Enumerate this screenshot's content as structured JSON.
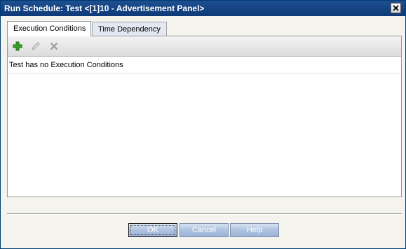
{
  "window": {
    "title": "Run Schedule: Test <[1]10 - Advertisement Panel>"
  },
  "tabs": [
    {
      "label": "Execution Conditions",
      "active": true
    },
    {
      "label": "Time Dependency",
      "active": false
    }
  ],
  "toolbar": {
    "buttons": [
      {
        "icon": "add-icon",
        "enabled": true
      },
      {
        "icon": "edit-pencil-icon",
        "enabled": false
      },
      {
        "icon": "delete-x-icon",
        "enabled": false
      }
    ]
  },
  "panel": {
    "message": "Test has no Execution Conditions"
  },
  "footer": {
    "ok_label": "OK",
    "cancel_label": "Cancel",
    "help_label": "Help"
  },
  "colors": {
    "titlebar": "#0e3a78",
    "button": "#9cb4d8",
    "add_icon": "#3aa12a"
  }
}
